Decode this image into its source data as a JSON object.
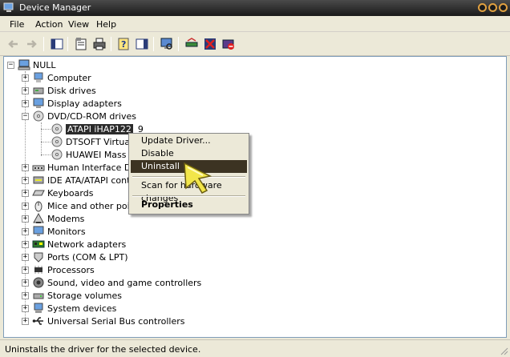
{
  "window": {
    "title": "Device Manager"
  },
  "menu": [
    "File",
    "Action",
    "View",
    "Help"
  ],
  "tree": {
    "root": "NULL",
    "categories": [
      {
        "label": "Computer",
        "icon": "computer-icon",
        "expanded": false
      },
      {
        "label": "Disk drives",
        "icon": "disk-drive-icon",
        "expanded": false
      },
      {
        "label": "Display adapters",
        "icon": "display-adapter-icon",
        "expanded": false
      },
      {
        "label": "DVD/CD-ROM drives",
        "icon": "cdrom-icon",
        "expanded": true,
        "children": [
          "ATAPI iHAP122",
          "DTSOFT Virtual C",
          "HUAWEI Mass St"
        ]
      },
      {
        "label": "Human Interface Devi",
        "icon": "hid-icon",
        "expanded": false
      },
      {
        "label": "IDE ATA/ATAPI contro",
        "icon": "ide-icon",
        "expanded": false
      },
      {
        "label": "Keyboards",
        "icon": "keyboard-icon",
        "expanded": false
      },
      {
        "label": "Mice and other pointing",
        "icon": "mouse-icon",
        "expanded": false
      },
      {
        "label": "Modems",
        "icon": "modem-icon",
        "expanded": false
      },
      {
        "label": "Monitors",
        "icon": "monitor-icon",
        "expanded": false
      },
      {
        "label": "Network adapters",
        "icon": "network-adapter-icon",
        "expanded": false
      },
      {
        "label": "Ports (COM & LPT)",
        "icon": "port-icon",
        "expanded": false
      },
      {
        "label": "Processors",
        "icon": "processor-icon",
        "expanded": false
      },
      {
        "label": "Sound, video and game controllers",
        "icon": "sound-icon",
        "expanded": false
      },
      {
        "label": "Storage volumes",
        "icon": "storage-icon",
        "expanded": false
      },
      {
        "label": "System devices",
        "icon": "system-device-icon",
        "expanded": false
      },
      {
        "label": "Universal Serial Bus controllers",
        "icon": "usb-icon",
        "expanded": false
      }
    ],
    "selected_child_suffix": "9"
  },
  "context_menu": {
    "items": [
      {
        "label": "Update Driver...",
        "highlighted": false
      },
      {
        "label": "Disable",
        "highlighted": false
      },
      {
        "label": "Uninstall",
        "highlighted": true
      },
      {
        "label": "Scan for hardware changes",
        "highlighted": false
      },
      {
        "label": "Properties",
        "highlighted": false,
        "bold": true
      }
    ]
  },
  "status": {
    "text": "Uninstalls the driver for the selected device."
  },
  "colors": {
    "titlebar": "#1a1a1a",
    "highlight": "#3c3322",
    "selection": "#2b2b2b"
  }
}
